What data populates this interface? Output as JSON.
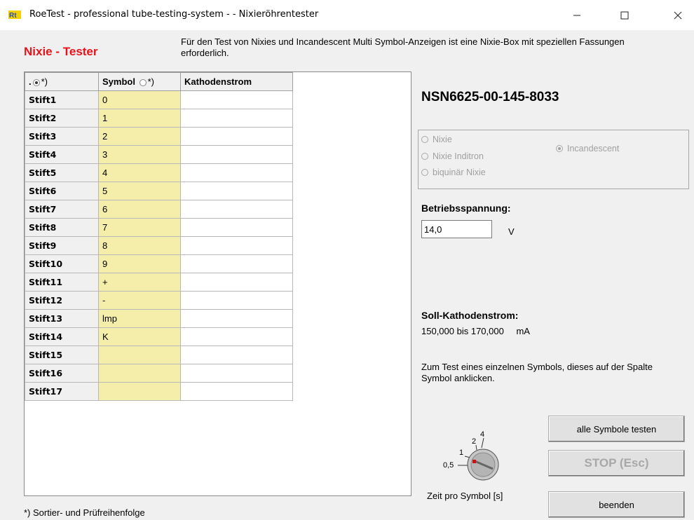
{
  "window": {
    "title": "RoeTest - professional tube-testing-system -  - Nixieröhrentester",
    "min_icon": "minimize-icon",
    "max_icon": "maximize-icon",
    "close_icon": "close-icon",
    "app_icon": "roetest-logo-icon"
  },
  "header": {
    "title": "Nixie - Tester",
    "info": "Für den Test von Nixies und Incandescent Multi Symbol-Anzeigen ist eine Nixie-Box mit speziellen Fassungen erforderlich.",
    "title_color": "#e8121a"
  },
  "grid": {
    "columns": [
      {
        "prefix": ".",
        "suffix": "*)",
        "radio_selected": true
      },
      {
        "prefix": "Symbol",
        "suffix": "*)",
        "radio_selected": false
      },
      {
        "prefix": "Kathodenstrom",
        "suffix": ""
      }
    ],
    "rows": [
      {
        "pin": "Stift1",
        "symbol": "0",
        "current": ""
      },
      {
        "pin": "Stift2",
        "symbol": "1",
        "current": ""
      },
      {
        "pin": "Stift3",
        "symbol": "2",
        "current": ""
      },
      {
        "pin": "Stift4",
        "symbol": "3",
        "current": ""
      },
      {
        "pin": "Stift5",
        "symbol": "4",
        "current": ""
      },
      {
        "pin": "Stift6",
        "symbol": "5",
        "current": ""
      },
      {
        "pin": "Stift7",
        "symbol": "6",
        "current": ""
      },
      {
        "pin": "Stift8",
        "symbol": "7",
        "current": ""
      },
      {
        "pin": "Stift9",
        "symbol": "8",
        "current": ""
      },
      {
        "pin": "Stift10",
        "symbol": "9",
        "current": ""
      },
      {
        "pin": "Stift11",
        "symbol": "+",
        "current": ""
      },
      {
        "pin": "Stift12",
        "symbol": "-",
        "current": ""
      },
      {
        "pin": "Stift13",
        "symbol": "lmp",
        "current": ""
      },
      {
        "pin": "Stift14",
        "symbol": "K",
        "current": ""
      },
      {
        "pin": "Stift15",
        "symbol": "",
        "current": ""
      },
      {
        "pin": "Stift16",
        "symbol": "",
        "current": ""
      },
      {
        "pin": "Stift17",
        "symbol": "",
        "current": ""
      }
    ],
    "symbol_bg": "#f4eeaa",
    "footnote": "*) Sortier- und Prüfreihenfolge"
  },
  "tube": {
    "name": "NSN6625-00-145-8033"
  },
  "type_options": [
    {
      "label": "Nixie",
      "selected": false
    },
    {
      "label": "Nixie Inditron",
      "selected": false
    },
    {
      "label": "biquinär Nixie",
      "selected": false
    },
    {
      "label": "Incandescent",
      "selected": true
    }
  ],
  "voltage": {
    "label": "Betriebsspannung:",
    "value": "14,0",
    "unit": "V"
  },
  "soll": {
    "label": "Soll-Kathodenstrom:",
    "value": "150,000 bis 170,000",
    "unit": "mA"
  },
  "hint": "Zum Test eines einzelnen Symbols, dieses auf der Spalte Symbol anklicken.",
  "dial": {
    "labels": [
      "0,5",
      "1",
      "2",
      "4"
    ],
    "selected": "0,5",
    "caption": "Zeit pro Symbol [s]"
  },
  "buttons": {
    "test_all": "alle Symbole testen",
    "stop": "STOP (Esc)",
    "end": "beenden"
  }
}
